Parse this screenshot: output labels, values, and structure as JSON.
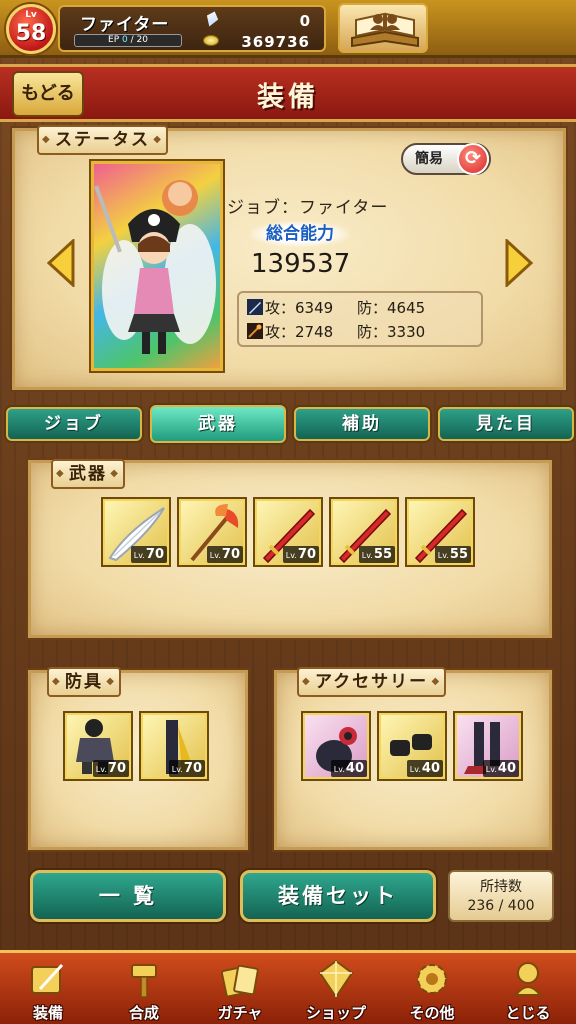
{
  "hud": {
    "level_label": "Lv",
    "level": "58",
    "job_name": "ファイター",
    "ep_label": "EP",
    "ep_current": "0",
    "ep_max": "/ 20",
    "ep_fill": 0,
    "crystal_count": "0",
    "gold_count": "369736"
  },
  "header": {
    "back_label": "もどる",
    "title": "装備"
  },
  "status": {
    "section_label": "ステータス",
    "simple_label": "簡易",
    "job_line": "ジョブ：ファイター",
    "power_label": "総合能力",
    "power_value": "139537",
    "physical": {
      "atk_label": "攻：6349",
      "def_label": "防：4645"
    },
    "magic": {
      "atk_label": "攻：2748",
      "def_label": "防：3330"
    }
  },
  "tabs": [
    {
      "label": "ジョブ",
      "active": false
    },
    {
      "label": "武器",
      "active": true
    },
    {
      "label": "補助",
      "active": false
    },
    {
      "label": "見た目",
      "active": false
    }
  ],
  "weapons": {
    "section_label": "武器",
    "items": [
      {
        "icon": "feather-blade-icon",
        "lv": "70"
      },
      {
        "icon": "flame-axe-icon",
        "lv": "70"
      },
      {
        "icon": "red-sword-icon",
        "lv": "70"
      },
      {
        "icon": "red-sword-icon",
        "lv": "55"
      },
      {
        "icon": "red-sword-icon",
        "lv": "55"
      }
    ]
  },
  "armor": {
    "section_label": "防具",
    "items": [
      {
        "icon": "dark-armor-icon",
        "lv": "70"
      },
      {
        "icon": "dark-cape-icon",
        "lv": "70"
      }
    ]
  },
  "accessories": {
    "section_label": "アクセサリー",
    "items": [
      {
        "icon": "bag-icon",
        "lv": "40"
      },
      {
        "icon": "gloves-icon",
        "lv": "40"
      },
      {
        "icon": "boots-icon",
        "lv": "40"
      }
    ]
  },
  "actions": {
    "list_label": "一 覧",
    "set_label": "装備セット",
    "owned_label": "所持数",
    "owned_value": "236 / 400"
  },
  "nav": [
    {
      "label": "装備",
      "icon": "equip-icon"
    },
    {
      "label": "合成",
      "icon": "hammer-icon"
    },
    {
      "label": "ガチャ",
      "icon": "gacha-icon"
    },
    {
      "label": "ショップ",
      "icon": "crystal-shop-icon"
    },
    {
      "label": "その他",
      "icon": "gear-icon"
    },
    {
      "label": "とじる",
      "icon": "close-icon"
    }
  ],
  "colors": {
    "header_red": "#a82418",
    "tab_green": "#1f8a72",
    "parchment": "#f1dba7",
    "gold_border": "#d9a83a"
  }
}
